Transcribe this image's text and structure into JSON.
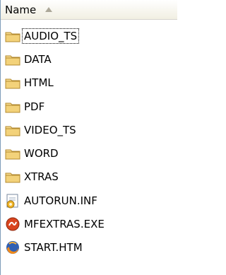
{
  "header": {
    "name_label": "Name",
    "sort_icon": "sort-ascending-icon"
  },
  "files": [
    {
      "name": "AUDIO_TS",
      "type": "folder",
      "icon": "folder-icon",
      "focused": true
    },
    {
      "name": "DATA",
      "type": "folder",
      "icon": "folder-icon"
    },
    {
      "name": "HTML",
      "type": "folder",
      "icon": "folder-icon"
    },
    {
      "name": "PDF",
      "type": "folder",
      "icon": "folder-icon"
    },
    {
      "name": "VIDEO_TS",
      "type": "folder",
      "icon": "folder-icon"
    },
    {
      "name": "WORD",
      "type": "folder",
      "icon": "folder-icon"
    },
    {
      "name": "XTRAS",
      "type": "folder",
      "icon": "folder-icon"
    },
    {
      "name": "AUTORUN.INF",
      "type": "config",
      "icon": "setup-info-icon"
    },
    {
      "name": "MFEXTRAS.EXE",
      "type": "exe",
      "icon": "shockwave-exe-icon"
    },
    {
      "name": "START.HTM",
      "type": "html",
      "icon": "firefox-html-icon"
    }
  ],
  "colors": {
    "folder": "#f3d27a",
    "folder_edge": "#b38a2f",
    "border": "#7f9db9"
  }
}
